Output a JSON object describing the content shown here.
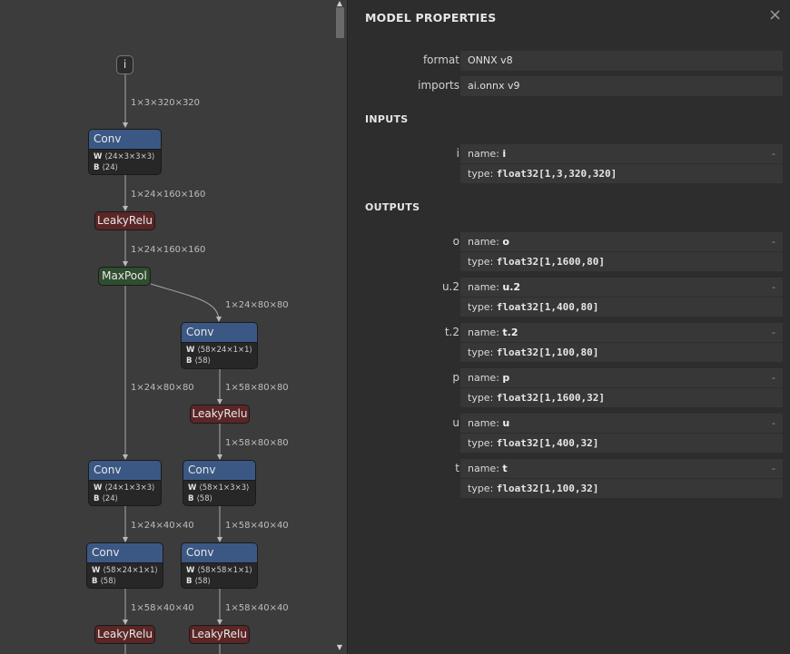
{
  "graph": {
    "input_node": "i",
    "nodes": {
      "conv1": {
        "op": "Conv",
        "w_key": "W",
        "w": "⟨24×3×3×3⟩",
        "b_key": "B",
        "b": "⟨24⟩"
      },
      "relu1": {
        "op": "LeakyRelu"
      },
      "pool1": {
        "op": "MaxPool"
      },
      "conv2": {
        "op": "Conv",
        "w_key": "W",
        "w": "⟨58×24×1×1⟩",
        "b_key": "B",
        "b": "⟨58⟩"
      },
      "relu2": {
        "op": "LeakyRelu"
      },
      "conv3": {
        "op": "Conv",
        "w_key": "W",
        "w": "⟨24×1×3×3⟩",
        "b_key": "B",
        "b": "⟨24⟩"
      },
      "conv4": {
        "op": "Conv",
        "w_key": "W",
        "w": "⟨58×1×3×3⟩",
        "b_key": "B",
        "b": "⟨58⟩"
      },
      "conv5": {
        "op": "Conv",
        "w_key": "W",
        "w": "⟨58×24×1×1⟩",
        "b_key": "B",
        "b": "⟨58⟩"
      },
      "conv6": {
        "op": "Conv",
        "w_key": "W",
        "w": "⟨58×58×1×1⟩",
        "b_key": "B",
        "b": "⟨58⟩"
      },
      "relu3": {
        "op": "LeakyRelu"
      },
      "relu4": {
        "op": "LeakyRelu"
      }
    },
    "edges": {
      "e1": "1×3×320×320",
      "e2": "1×24×160×160",
      "e3": "1×24×160×160",
      "e4": "1×24×80×80",
      "e5": "1×24×80×80",
      "e6": "1×58×80×80",
      "e7": "1×58×80×80",
      "e8": "1×24×40×40",
      "e9": "1×58×40×40",
      "e10": "1×58×40×40",
      "e11": "1×58×40×40"
    }
  },
  "panel": {
    "title": "MODEL PROPERTIES",
    "close": "×",
    "props": [
      {
        "key": "format",
        "value": "ONNX v8"
      },
      {
        "key": "imports",
        "value": "ai.onnx v9"
      }
    ],
    "inputs_title": "INPUTS",
    "outputs_title": "OUTPUTS",
    "name_label": "name:",
    "type_label": "type:",
    "expand": "-",
    "inputs": [
      {
        "key": "i",
        "name": "i",
        "type": "float32[1,3,320,320]"
      }
    ],
    "outputs": [
      {
        "key": "o",
        "name": "o",
        "type": "float32[1,1600,80]"
      },
      {
        "key": "u.2",
        "name": "u.2",
        "type": "float32[1,400,80]"
      },
      {
        "key": "t.2",
        "name": "t.2",
        "type": "float32[1,100,80]"
      },
      {
        "key": "p",
        "name": "p",
        "type": "float32[1,1600,32]"
      },
      {
        "key": "u",
        "name": "u",
        "type": "float32[1,400,32]"
      },
      {
        "key": "t",
        "name": "t",
        "type": "float32[1,100,32]"
      }
    ]
  },
  "colors": {
    "conv_header": "#3b5884",
    "activation": "#5b2626",
    "pool": "#2f4d2f"
  }
}
